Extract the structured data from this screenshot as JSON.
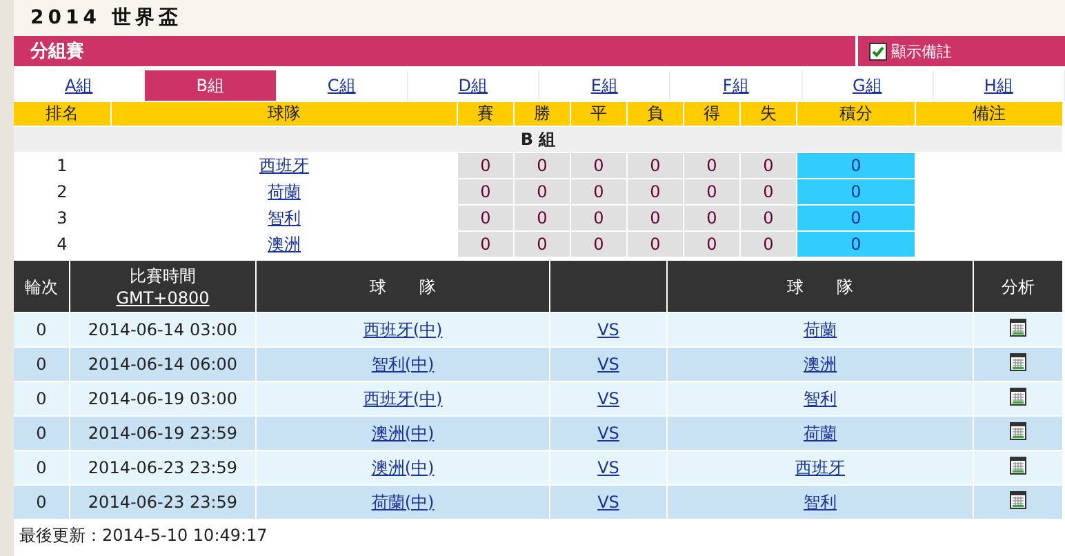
{
  "title": "2014 世界盃",
  "section_bar": {
    "title": "分組賽",
    "show_notes": {
      "label": "顯示備註",
      "checked": true
    }
  },
  "group_tabs": [
    {
      "label": "A組",
      "selected": false
    },
    {
      "label": "B組",
      "selected": true
    },
    {
      "label": "C組",
      "selected": false
    },
    {
      "label": "D組",
      "selected": false
    },
    {
      "label": "E組",
      "selected": false
    },
    {
      "label": "F組",
      "selected": false
    },
    {
      "label": "G組",
      "selected": false
    },
    {
      "label": "H組",
      "selected": false
    }
  ],
  "standings": {
    "columns": [
      "排名",
      "球隊",
      "賽",
      "勝",
      "平",
      "負",
      "得",
      "失",
      "積分",
      "備注"
    ],
    "group_label": "B 組",
    "rows": [
      {
        "rank": "1",
        "team": "西班牙",
        "stats": [
          "0",
          "0",
          "0",
          "0",
          "0",
          "0"
        ],
        "points": "0"
      },
      {
        "rank": "2",
        "team": "荷蘭",
        "stats": [
          "0",
          "0",
          "0",
          "0",
          "0",
          "0"
        ],
        "points": "0"
      },
      {
        "rank": "3",
        "team": "智利",
        "stats": [
          "0",
          "0",
          "0",
          "0",
          "0",
          "0"
        ],
        "points": "0"
      },
      {
        "rank": "4",
        "team": "澳洲",
        "stats": [
          "0",
          "0",
          "0",
          "0",
          "0",
          "0"
        ],
        "points": "0"
      }
    ]
  },
  "matches": {
    "columns": {
      "round": "輪次",
      "time": "比賽時間",
      "timezone": "GMT+0800",
      "home": "球　　隊",
      "away": "球　　隊",
      "analysis": "分析"
    },
    "rows": [
      {
        "round": "0",
        "time": "2014-06-14 03:00",
        "home": "西班牙(中)",
        "vs": "VS",
        "away": "荷蘭"
      },
      {
        "round": "0",
        "time": "2014-06-14 06:00",
        "home": "智利(中)",
        "vs": "VS",
        "away": "澳洲"
      },
      {
        "round": "0",
        "time": "2014-06-19 03:00",
        "home": "西班牙(中)",
        "vs": "VS",
        "away": "智利"
      },
      {
        "round": "0",
        "time": "2014-06-19 23:59",
        "home": "澳洲(中)",
        "vs": "VS",
        "away": "荷蘭"
      },
      {
        "round": "0",
        "time": "2014-06-23 23:59",
        "home": "澳洲(中)",
        "vs": "VS",
        "away": "西班牙"
      },
      {
        "round": "0",
        "time": "2014-06-23 23:59",
        "home": "荷蘭(中)",
        "vs": "VS",
        "away": "智利"
      }
    ]
  },
  "footer": "最後更新：2014-5-10 10:49:17"
}
